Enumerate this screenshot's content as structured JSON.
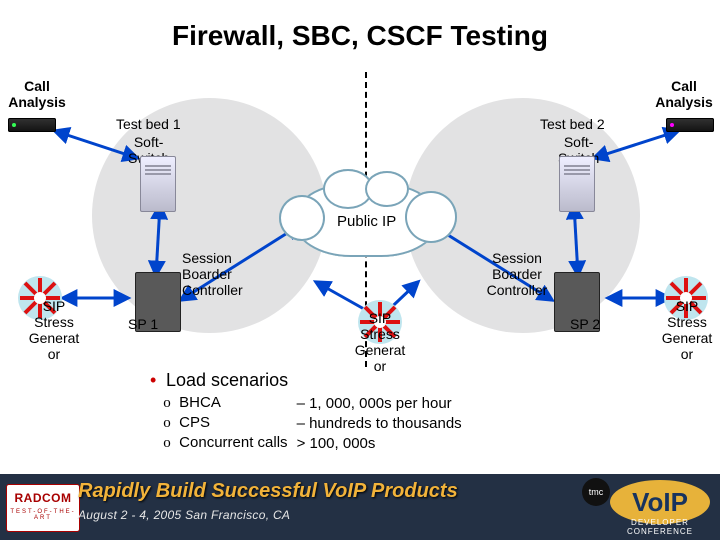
{
  "title": "Firewall, SBC, CSCF Testing",
  "labels": {
    "call_analysis_left": "Call\nAnalysis",
    "call_analysis_right": "Call\nAnalysis",
    "testbed1": "Test bed 1",
    "testbed2": "Test bed 2",
    "softswitch1": "Soft-\nSwitch",
    "softswitch2": "Soft-\nSwitch",
    "public_ip": "Public IP",
    "sbc_left": "Session\nBoarder\nController",
    "sbc_right": "Session\nBoarder\nController",
    "sip_stress_left": "SIP\nStress\nGenerat\nor",
    "sip_stress_mid": "SIP\nStress\nGenerat\nor",
    "sip_stress_right": "SIP\nStress\nGenerat\nor",
    "sp1": "SP 1",
    "sp2": "SP 2"
  },
  "bullets": {
    "heading": "Load scenarios",
    "rows": [
      {
        "metric": "BHCA",
        "value": "– 1, 000, 000s per hour"
      },
      {
        "metric": "CPS",
        "value": "– hundreds to thousands"
      },
      {
        "metric": "Concurrent calls",
        "value": "> 100, 000s"
      }
    ]
  },
  "footer": {
    "headline": "Rapidly Build Successful VoIP Products",
    "sub": "August 2 - 4, 2005 San Francisco, CA",
    "radcom_brand": "RADCOM",
    "radcom_tag": "TEST-OF-THE-ART",
    "voip_text": "VoIP",
    "tmc": "tmc",
    "conf": "DEVELOPER CONFERENCE"
  }
}
